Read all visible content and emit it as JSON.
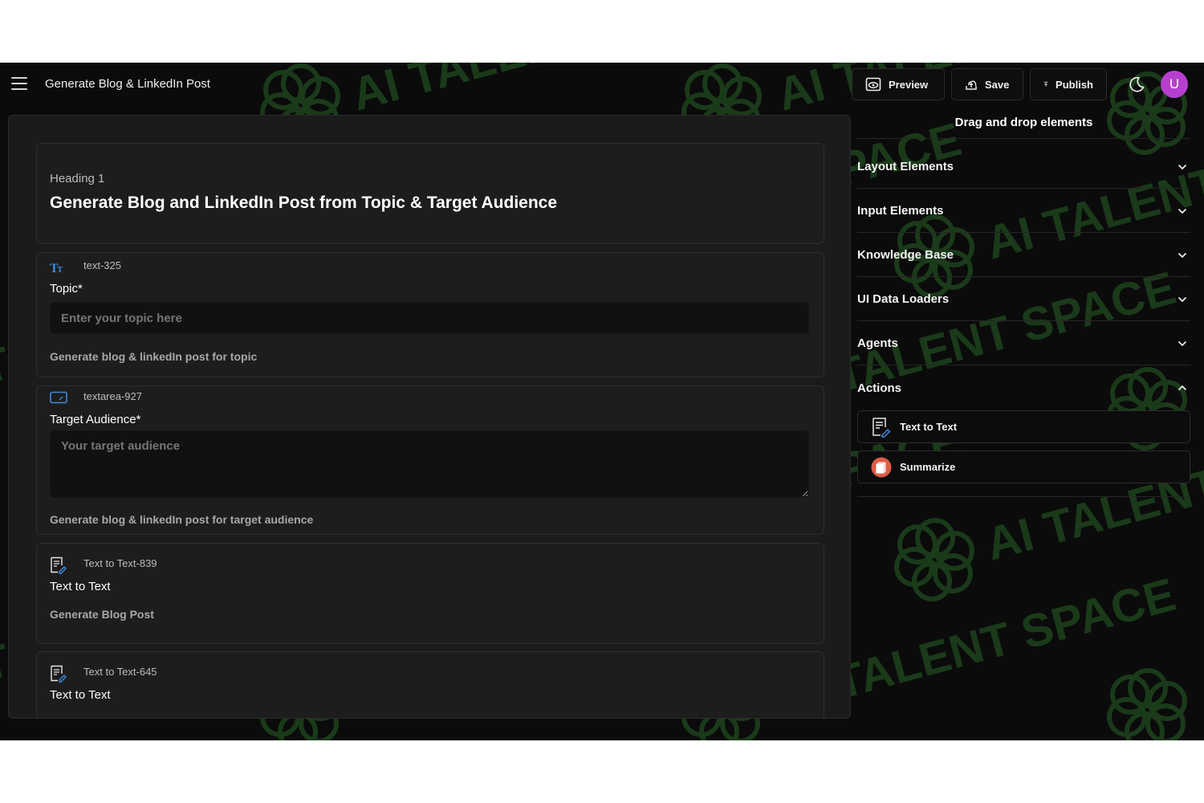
{
  "header": {
    "title": "Generate Blog & LinkedIn Post",
    "preview_label": "Preview",
    "save_label": "Save",
    "publish_label": "Publish",
    "avatar_initial": "U"
  },
  "watermark": {
    "text": "AI TALENT SPACE"
  },
  "canvas": {
    "heading_card": {
      "type_label": "Heading 1",
      "text": "Generate Blog and LinkedIn Post from Topic & Target Audience"
    },
    "topic_card": {
      "tag": "text-325",
      "label": "Topic*",
      "placeholder": "Enter your topic here",
      "help": "Generate blog & linkedIn post for topic"
    },
    "audience_card": {
      "tag": "textarea-927",
      "label": "Target Audience*",
      "placeholder": "Your target audience",
      "help": "Generate blog & linkedIn post for target audience"
    },
    "t2t_card_1": {
      "tag": "Text to Text-839",
      "label": "Text to Text",
      "help": "Generate Blog Post"
    },
    "t2t_card_2": {
      "tag": "Text to Text-645",
      "label": "Text to Text"
    }
  },
  "panel": {
    "title": "Drag and drop elements",
    "sections": [
      {
        "label": "Layout Elements",
        "expanded": false
      },
      {
        "label": "Input Elements",
        "expanded": false
      },
      {
        "label": "Knowledge Base",
        "expanded": false
      },
      {
        "label": "UI Data Loaders",
        "expanded": false
      },
      {
        "label": "Agents",
        "expanded": false
      },
      {
        "label": "Actions",
        "expanded": true
      }
    ],
    "actions": [
      {
        "label": "Text to Text",
        "icon": "document-edit-icon"
      },
      {
        "label": "Summarize",
        "icon": "summarize-icon"
      }
    ]
  },
  "colors": {
    "background": "#0b0b0b",
    "canvas": "#1b1b1b",
    "avatar": "#b63fcf",
    "watermark": "#1a3a1a",
    "accent_blue": "#3d8bdc"
  }
}
